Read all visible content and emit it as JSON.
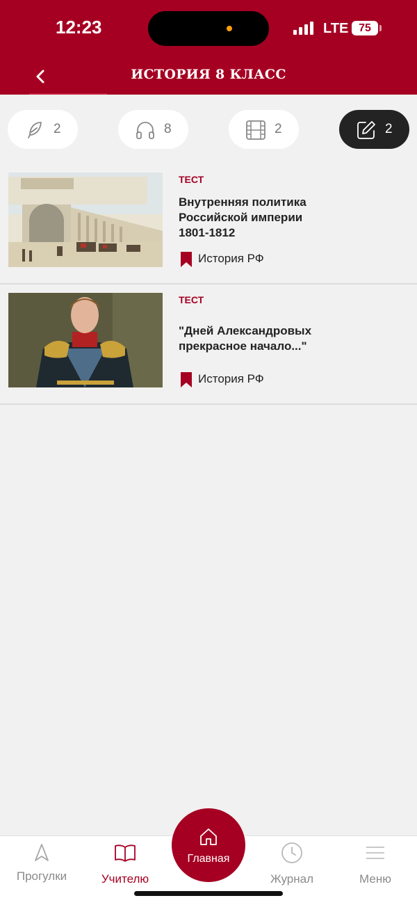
{
  "status_bar": {
    "time": "12:23",
    "network": "LTE",
    "battery": "75"
  },
  "header": {
    "title": "ИСТОРИЯ 8 КЛАСС"
  },
  "filters": [
    {
      "icon": "feather-icon",
      "count": "2",
      "active": false
    },
    {
      "icon": "headphones-icon",
      "count": "8",
      "active": false
    },
    {
      "icon": "film-icon",
      "count": "2",
      "active": false
    },
    {
      "icon": "edit-icon",
      "count": "2",
      "active": true
    }
  ],
  "items": [
    {
      "type": "ТЕСТ",
      "title": "Внутренняя политика Российской империи 1801-1812",
      "tag": "История РФ",
      "image": "general-staff-building-painting"
    },
    {
      "type": "ТЕСТ",
      "title": "\"Дней Александровых прекрасное начало...\"",
      "tag": "История РФ",
      "image": "alexander-i-portrait"
    }
  ],
  "tabbar": {
    "tabs": [
      {
        "label": "Прогулки",
        "icon": "navigation-arrow-icon",
        "selected": false
      },
      {
        "label": "Учителю",
        "icon": "book-icon",
        "selected": true
      },
      {
        "label": "Журнал",
        "icon": "clock-icon",
        "selected": false
      },
      {
        "label": "Меню",
        "icon": "menu-icon",
        "selected": false
      }
    ],
    "home_label": "Главная"
  },
  "colors": {
    "brand": "#a50022",
    "active_chip": "#232323",
    "background": "#f1f1f1"
  }
}
